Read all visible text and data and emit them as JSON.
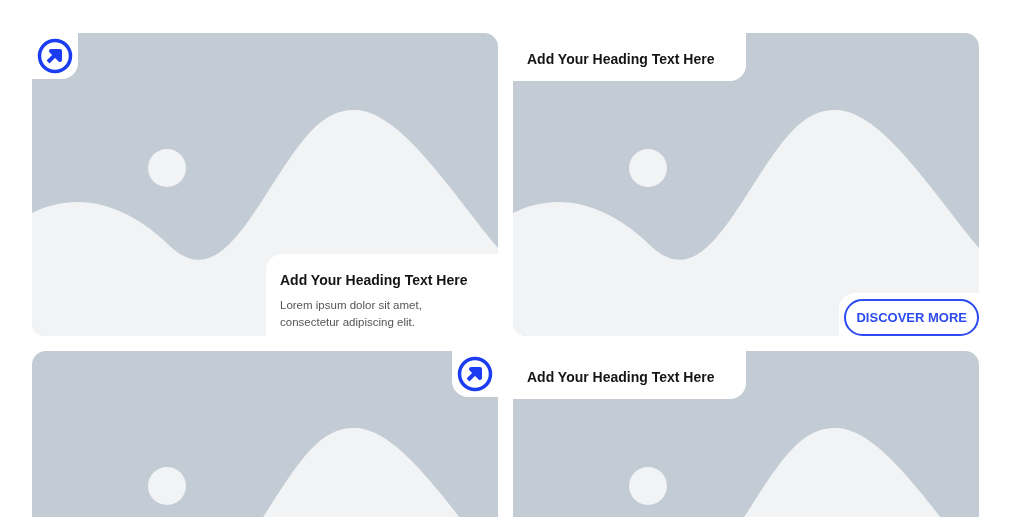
{
  "cards": [
    {
      "kind": "icon-caption",
      "heading": "Add Your Heading Text Here",
      "text": "Lorem ipsum dolor sit amet, consectetur adipiscing elit."
    },
    {
      "kind": "header-button",
      "heading": "Add Your Heading Text Here",
      "button": "DISCOVER MORE"
    },
    {
      "kind": "icon-right"
    },
    {
      "kind": "header",
      "heading": "Add Your Heading Text Here"
    }
  ]
}
